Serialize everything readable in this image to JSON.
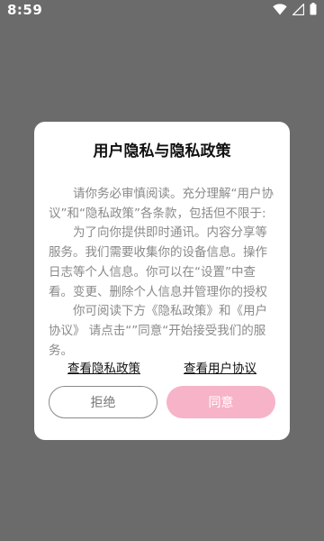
{
  "status_bar": {
    "time": "8:59",
    "icons": [
      "wifi-icon",
      "signal-icon",
      "battery-icon"
    ]
  },
  "dialog": {
    "title": "用户隐私与隐私政策",
    "paragraphs": [
      "请你务必审慎阅读。充分理解“用户协议”和“隐私政策”各条款，包括但不限于:",
      "为了向你提供即时通讯。内容分享等服务。我们需要收集你的设备信息。操作日志等个人信息。你可以在“设置”中查看。变更、删除个人信息并管理你的授权",
      "你可阅读下方《隐私政策》和《用户协议》 请点击“”同意“开始接受我们的服务。"
    ],
    "privacy_link": "查看隐私政策",
    "user_agreement_link": "查看用户协议",
    "reject_label": "拒绝",
    "agree_label": "同意"
  },
  "colors": {
    "backdrop": "#6b6b6b",
    "agree_button": "#f7b3c8",
    "body_text": "#8a8a8a"
  }
}
